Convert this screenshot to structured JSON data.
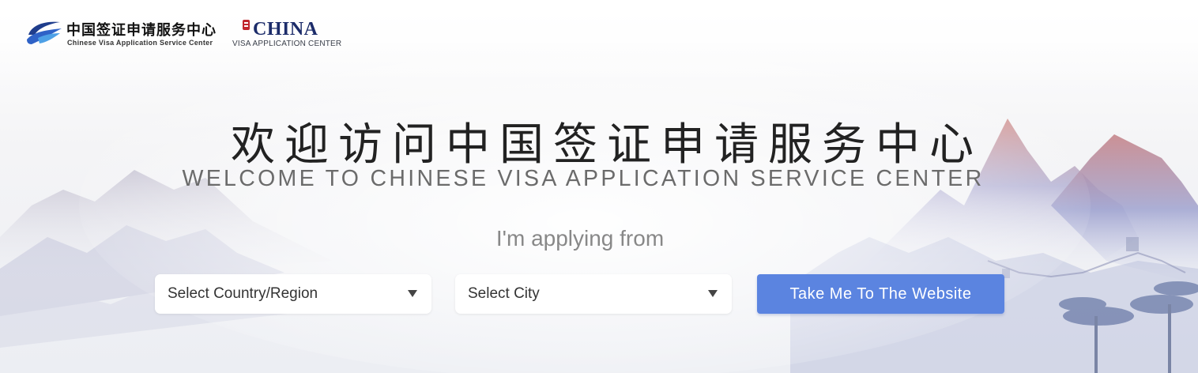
{
  "header": {
    "logo_cn": "中国签证申请服务中心",
    "logo_en": "Chinese Visa Application Service Center",
    "china_logo_text": "CHINA",
    "china_logo_sub": "VISA APPLICATION CENTER"
  },
  "hero": {
    "title_cn": "欢迎访问中国签证申请服务中心",
    "title_en": "WELCOME TO CHINESE VISA APPLICATION SERVICE CENTER",
    "applying_label": "I'm applying from"
  },
  "form": {
    "country_select": {
      "selected": "Select Country/Region"
    },
    "city_select": {
      "selected": "Select City"
    },
    "submit_label": "Take Me To The Website"
  },
  "icons": {
    "brand_logo": "swoosh-logo-icon",
    "china_mark": "seal-mark-icon",
    "dropdown": "caret-down-icon"
  },
  "colors": {
    "button": "#5b84e0",
    "brand_navy": "#1c2c6a",
    "mountain": "#c89ba8"
  }
}
